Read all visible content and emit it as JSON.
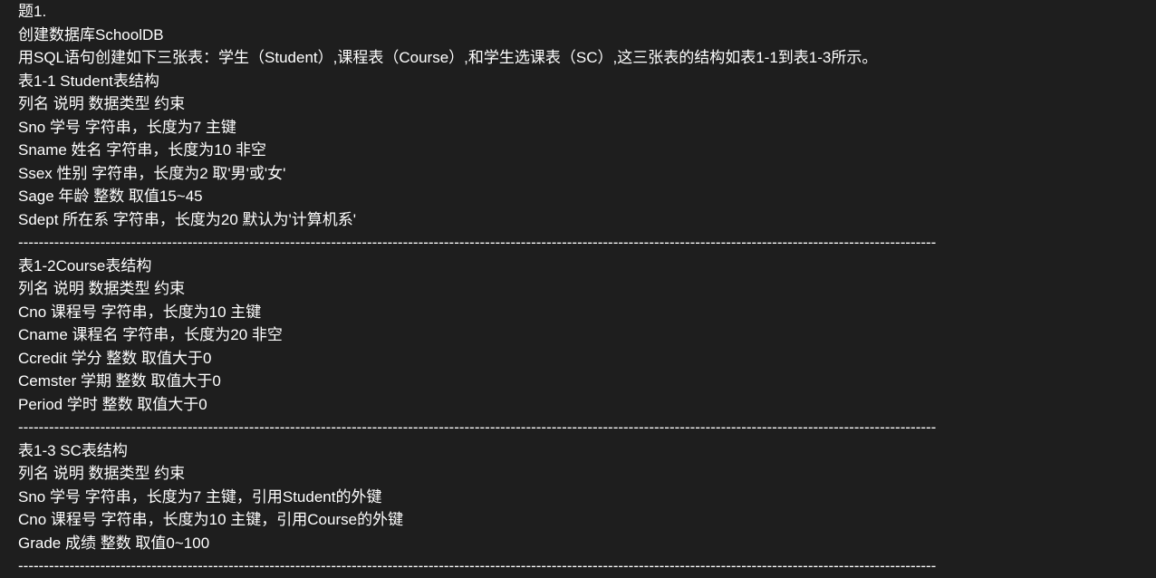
{
  "header": {
    "partial": "题1.",
    "line1": "创建数据库SchoolDB",
    "line2": "用SQL语句创建如下三张表：学生（Student）,课程表（Course）,和学生选课表（SC）,这三张表的结构如表1-1到表1-3所示。"
  },
  "table1": {
    "title": "表1-1 Student表结构",
    "header": "列名 说明 数据类型 约束",
    "rows": [
      "Sno 学号 字符串，长度为7 主键",
      "Sname 姓名 字符串，长度为10 非空",
      "Ssex 性别 字符串，长度为2 取'男'或'女'",
      "Sage 年龄 整数 取值15~45",
      "Sdept 所在系 字符串，长度为20 默认为'计算机系'"
    ]
  },
  "table2": {
    "title": "表1-2Course表结构",
    "header": "列名 说明 数据类型 约束",
    "rows": [
      "Cno 课程号 字符串，长度为10 主键",
      "Cname 课程名 字符串，长度为20 非空",
      "Ccredit 学分 整数 取值大于0",
      "Cemster 学期 整数 取值大于0",
      "Period 学时 整数 取值大于0"
    ]
  },
  "table3": {
    "title": "表1-3 SC表结构",
    "header": "列名 说明 数据类型 约束",
    "rows": [
      "Sno 学号 字符串，长度为7 主键，引用Student的外键",
      "Cno 课程号 字符串，长度为10 主键，引用Course的外键",
      "Grade 成绩 整数 取值0~100"
    ]
  },
  "divider": "-----------------------------------------------------------------------------------------------------------------------------------------------------------------------------------"
}
